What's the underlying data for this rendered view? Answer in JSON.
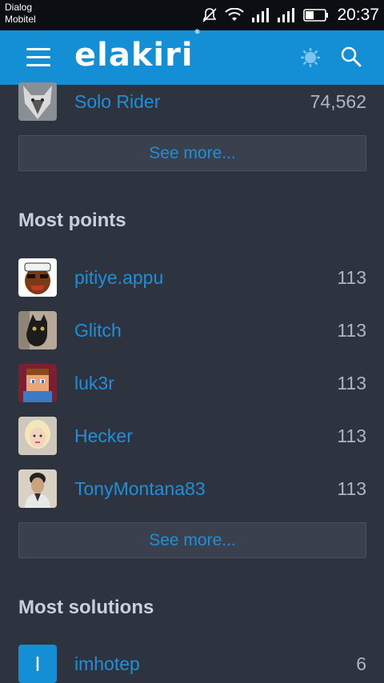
{
  "status_bar": {
    "carrier_line1": "Dialog",
    "carrier_line2": "Mobitel",
    "time": "20:37"
  },
  "header": {
    "logo_text": "elakiri",
    "logo_mark": "®"
  },
  "top_partial": {
    "name": "Solo Rider",
    "value": "74,562"
  },
  "see_more_label": "See more...",
  "sections": {
    "most_points": {
      "title": "Most points",
      "items": [
        {
          "name": "pitiye.appu",
          "value": "113"
        },
        {
          "name": "Glitch",
          "value": "113"
        },
        {
          "name": "luk3r",
          "value": "113"
        },
        {
          "name": "Hecker",
          "value": "113"
        },
        {
          "name": "TonyMontana83",
          "value": "113"
        }
      ]
    },
    "most_solutions": {
      "title": "Most solutions",
      "items": [
        {
          "name": "imhotep",
          "value": "6",
          "initial": "I"
        }
      ]
    }
  },
  "colors": {
    "header": "#148fd6",
    "background": "#2e3340",
    "link": "#1f8fd8"
  }
}
